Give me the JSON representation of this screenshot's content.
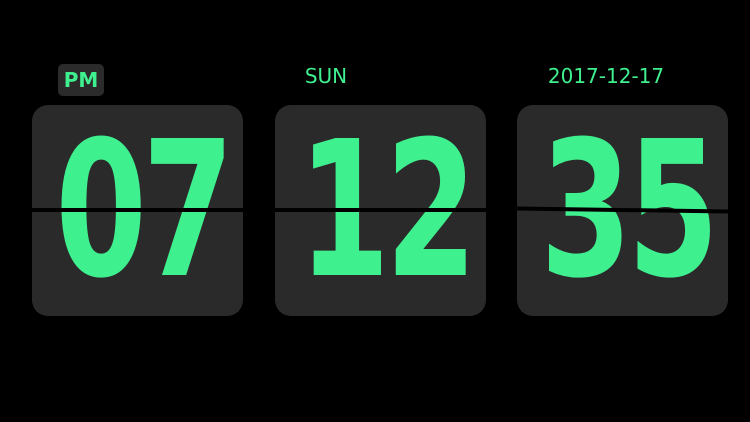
{
  "clock": {
    "ampm": "PM",
    "day": "SUN",
    "date": "2017-12-17",
    "hours": "07",
    "minutes": "12",
    "seconds": "35"
  },
  "colors": {
    "background": "#000000",
    "card": "#2a2a2a",
    "badge": "#2b2b2b",
    "digit": "#3ff08f",
    "divider": "#000000"
  }
}
